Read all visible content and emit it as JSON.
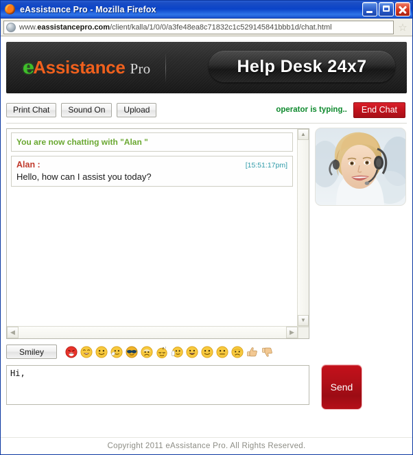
{
  "window": {
    "title": "eAssistance Pro - Mozilla Firefox",
    "browser_icon": "firefox-icon",
    "minimize_label": "Minimize",
    "maximize_label": "Maximize",
    "close_label": "Close"
  },
  "address_bar": {
    "url_prefix": "www.",
    "url_domain": "eassistancepro.com",
    "url_path": "/client/kalla/1/0/0/a3fe48ea8c71832c1c529145841bbb1d/chat.html",
    "full_url": "www.eassistancepro.com/client/kalla/1/0/0/a3fe48ea8c71832c1c529145841bbb1d/chat.html",
    "bookmark_icon": "star-icon",
    "site_icon": "globe-icon"
  },
  "banner": {
    "logo_e": "e",
    "logo_assistance": "Assistance",
    "logo_pro": "Pro",
    "helpdesk_title": "Help Desk 24x7"
  },
  "toolbar": {
    "print_chat_label": "Print Chat",
    "sound_label": "Sound On",
    "upload_label": "Upload",
    "typing_status": "operator is typing..",
    "end_chat_label": "End Chat",
    "typing_color": "#0f8a2e",
    "end_chat_color": "#c2131d"
  },
  "chat": {
    "system_message": "You are now chatting with \"Alan \"",
    "messages": [
      {
        "author": "Alan :",
        "time": "[15:51:17pm]",
        "body": "Hello, how can I assist you today?"
      }
    ],
    "scroll_up_icon": "chevron-up-icon",
    "scroll_down_icon": "chevron-down-icon",
    "scroll_left_icon": "chevron-left-icon",
    "scroll_right_icon": "chevron-right-icon",
    "author_color": "#c0392b",
    "time_color": "#2e9aa8",
    "system_color": "#6aa832"
  },
  "operator": {
    "photo_alt": "operator-photo"
  },
  "smiley_bar": {
    "button_label": "Smiley",
    "emojis": [
      {
        "name": "angry-emoji",
        "face": "#e8332a",
        "mouth": "open-angry"
      },
      {
        "name": "laughing-emoji",
        "face": "#f7c93e",
        "mouth": "big-open"
      },
      {
        "name": "smile-emoji",
        "face": "#f7c93e",
        "mouth": "smile"
      },
      {
        "name": "sick-mask-emoji",
        "face": "#f7c93e",
        "mouth": "covered"
      },
      {
        "name": "cool-sunglasses-emoji",
        "face": "#f0b429",
        "mouth": "smirk"
      },
      {
        "name": "sad-emoji",
        "face": "#f7c93e",
        "mouth": "frown"
      },
      {
        "name": "sleepy-emoji",
        "face": "#f7c93e",
        "mouth": "sleep"
      },
      {
        "name": "wave-hand-emoji",
        "face": "#f7c93e",
        "mouth": "smile"
      },
      {
        "name": "grin-emoji",
        "face": "#f7c93e",
        "mouth": "big-open"
      },
      {
        "name": "happy-emoji",
        "face": "#f7c93e",
        "mouth": "smile"
      },
      {
        "name": "neutral-emoji",
        "face": "#f7c93e",
        "mouth": "flat"
      },
      {
        "name": "worried-emoji",
        "face": "#f7c93e",
        "mouth": "frown"
      },
      {
        "name": "thumbs-up-emoji",
        "face": "#f0c48a",
        "mouth": "none"
      },
      {
        "name": "thumbs-down-emoji",
        "face": "#f0c48a",
        "mouth": "none"
      }
    ]
  },
  "composer": {
    "message_value": "Hi,",
    "message_placeholder": "",
    "send_label": "Send"
  },
  "footer": {
    "copyright": "Copyright 2011 eAssistance Pro. All Rights Reserved."
  }
}
